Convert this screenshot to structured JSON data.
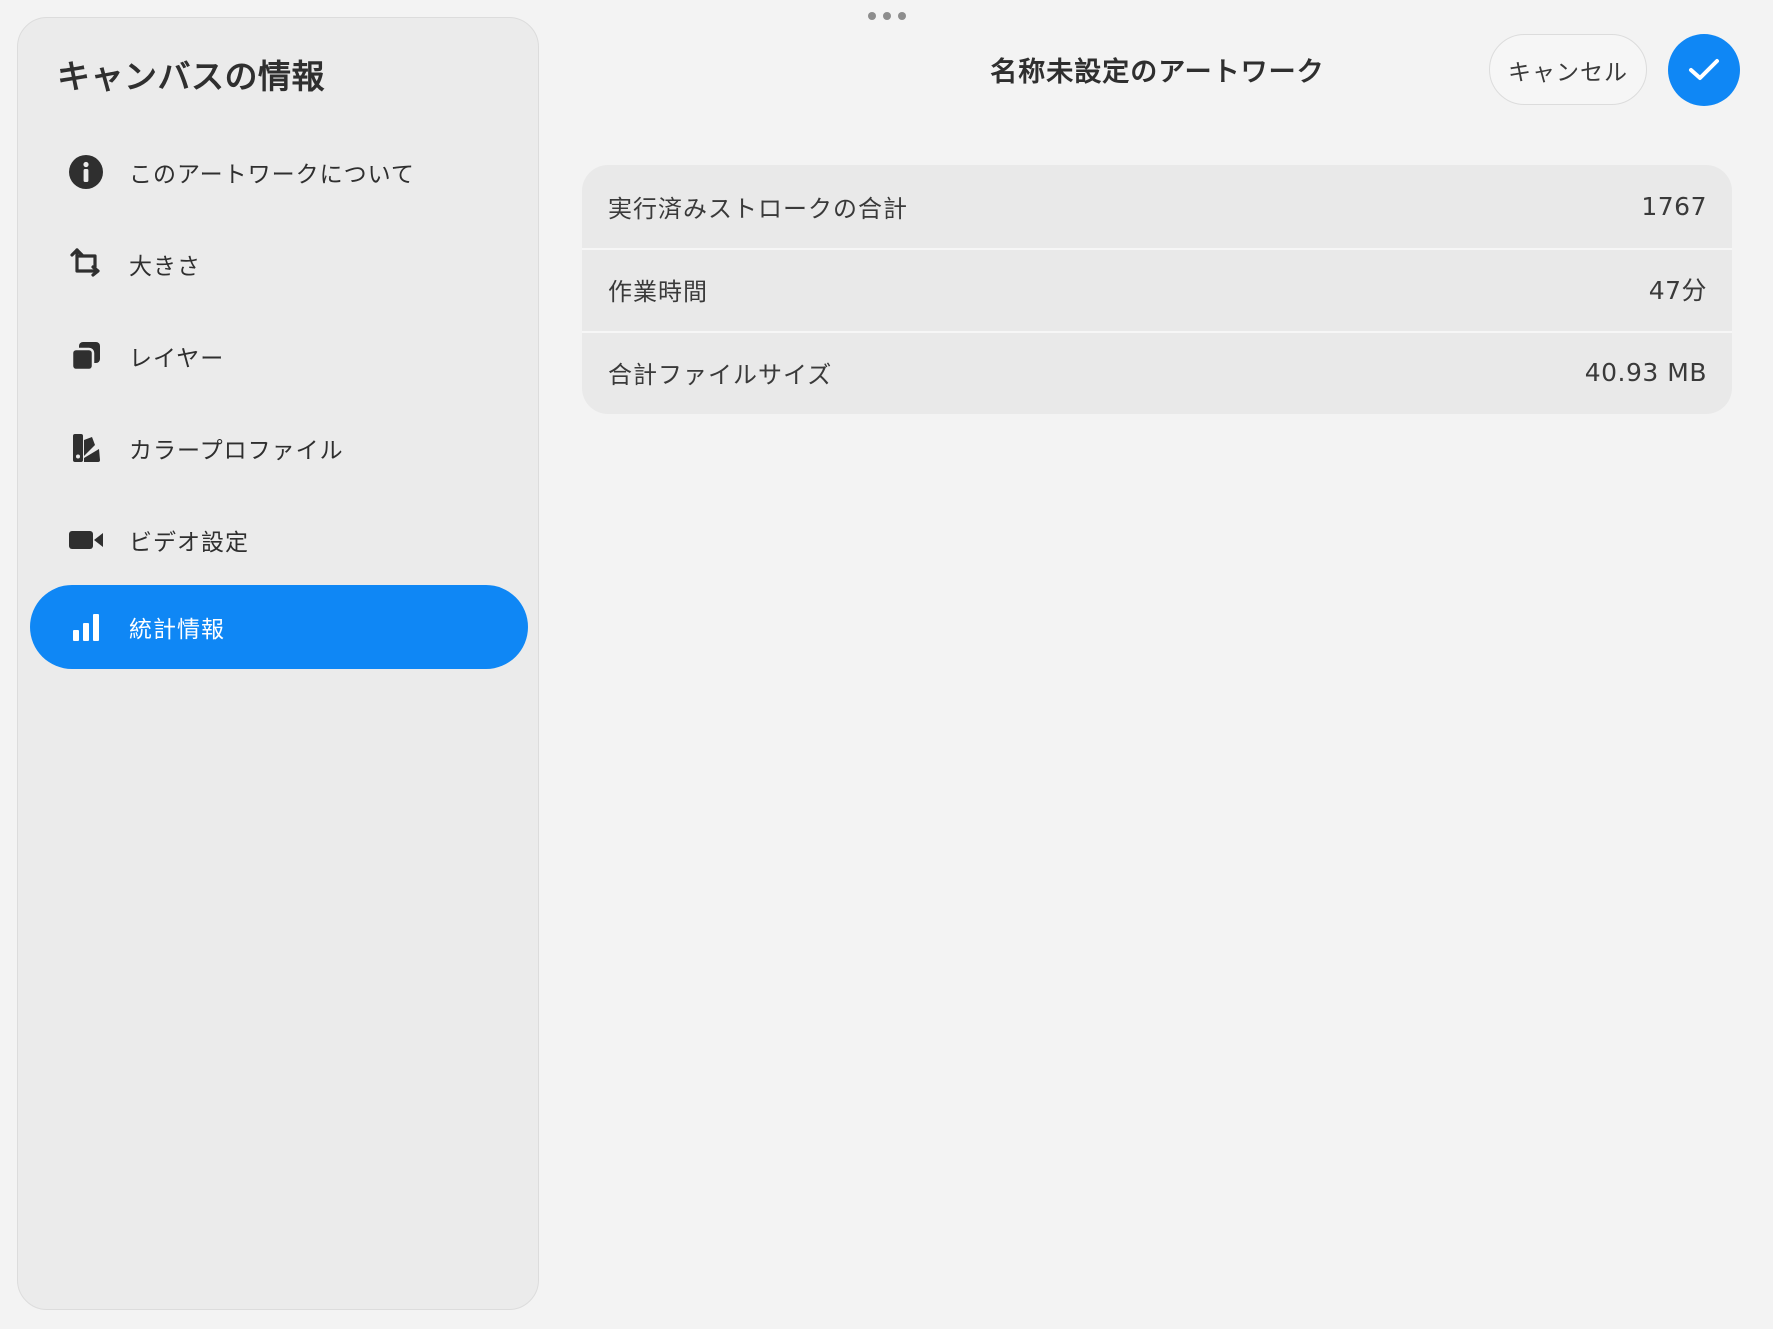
{
  "sidebar": {
    "title": "キャンバスの情報",
    "items": [
      {
        "label": "このアートワークについて",
        "icon": "info-icon"
      },
      {
        "label": "大きさ",
        "icon": "crop-icon"
      },
      {
        "label": "レイヤー",
        "icon": "layers-icon"
      },
      {
        "label": "カラープロファイル",
        "icon": "color-swatch-icon"
      },
      {
        "label": "ビデオ設定",
        "icon": "video-camera-icon"
      },
      {
        "label": "統計情報",
        "icon": "bar-chart-icon",
        "active": true
      }
    ]
  },
  "header": {
    "title": "名称未設定のアートワーク",
    "cancel_label": "キャンセル",
    "confirm_icon": "checkmark-icon"
  },
  "stats": [
    {
      "label": "実行済みストロークの合計",
      "value": "1767"
    },
    {
      "label": "作業時間",
      "value": "47分"
    },
    {
      "label": "合計ファイルサイズ",
      "value": "40.93 MB"
    }
  ],
  "colors": {
    "accent": "#0f87f5",
    "background": "#f3f3f3",
    "sidebar_background": "#ebebeb",
    "card_background": "#e9e9e9",
    "text": "#2f2f2f"
  }
}
